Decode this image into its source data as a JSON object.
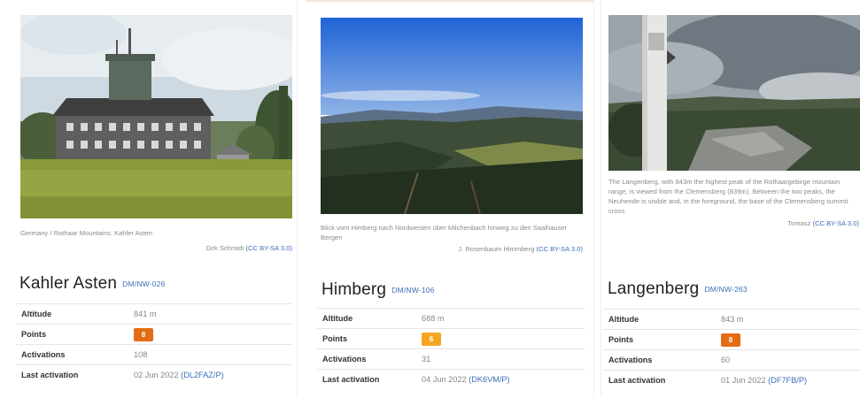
{
  "summits": [
    {
      "name": "Kahler Asten",
      "reference": "DM/NW-026",
      "caption": "Germany / Rothaar Mountains: Kahler Asten",
      "credit_author": "Dirk Schmidt",
      "credit_license": "(CC BY-SA 3.0)",
      "stats": {
        "altitude_label": "Altitude",
        "altitude": "841 m",
        "points_label": "Points",
        "points": "8",
        "activations_label": "Activations",
        "activations": "108",
        "last_label": "Last activation",
        "last_date": "02 Jun 2022",
        "last_call": "(DL2FAZ/P)"
      },
      "badge_color": "#e36c14"
    },
    {
      "name": "Himberg",
      "reference": "DM/NW-106",
      "caption": "Blick vom Himberg nach Nordwesten über Milchenbach hinweg zu den Saalhauser Bergen",
      "credit_author": "J. Rosenbaum Himmberg",
      "credit_license": "(CC BY-SA 3.0)",
      "stats": {
        "altitude_label": "Altitude",
        "altitude": "688 m",
        "points_label": "Points",
        "points": "6",
        "activations_label": "Activations",
        "activations": "31",
        "last_label": "Last activation",
        "last_date": "04 Jun 2022",
        "last_call": "(DK6VM/P)"
      },
      "badge_color": "#f4a623"
    },
    {
      "name": "Langenberg",
      "reference": "DM/NW-263",
      "caption": "The Langenberg, with 843m the highest peak of the Rothaargebirge mountain range, is viewed from the Clemensberg (839m). Between the two peaks, the Neuhende is visible and, in the foreground, the base of the Clemensberg summit cross.",
      "credit_author": "Tomasz",
      "credit_license": "(CC BY-SA 3.0)",
      "stats": {
        "altitude_label": "Altitude",
        "altitude": "843 m",
        "points_label": "Points",
        "points": "8",
        "activations_label": "Activations",
        "activations": "60",
        "last_label": "Last activation",
        "last_date": "01 Jun 2022",
        "last_call": "(DF7FB/P)"
      },
      "badge_color": "#e36c14"
    }
  ]
}
